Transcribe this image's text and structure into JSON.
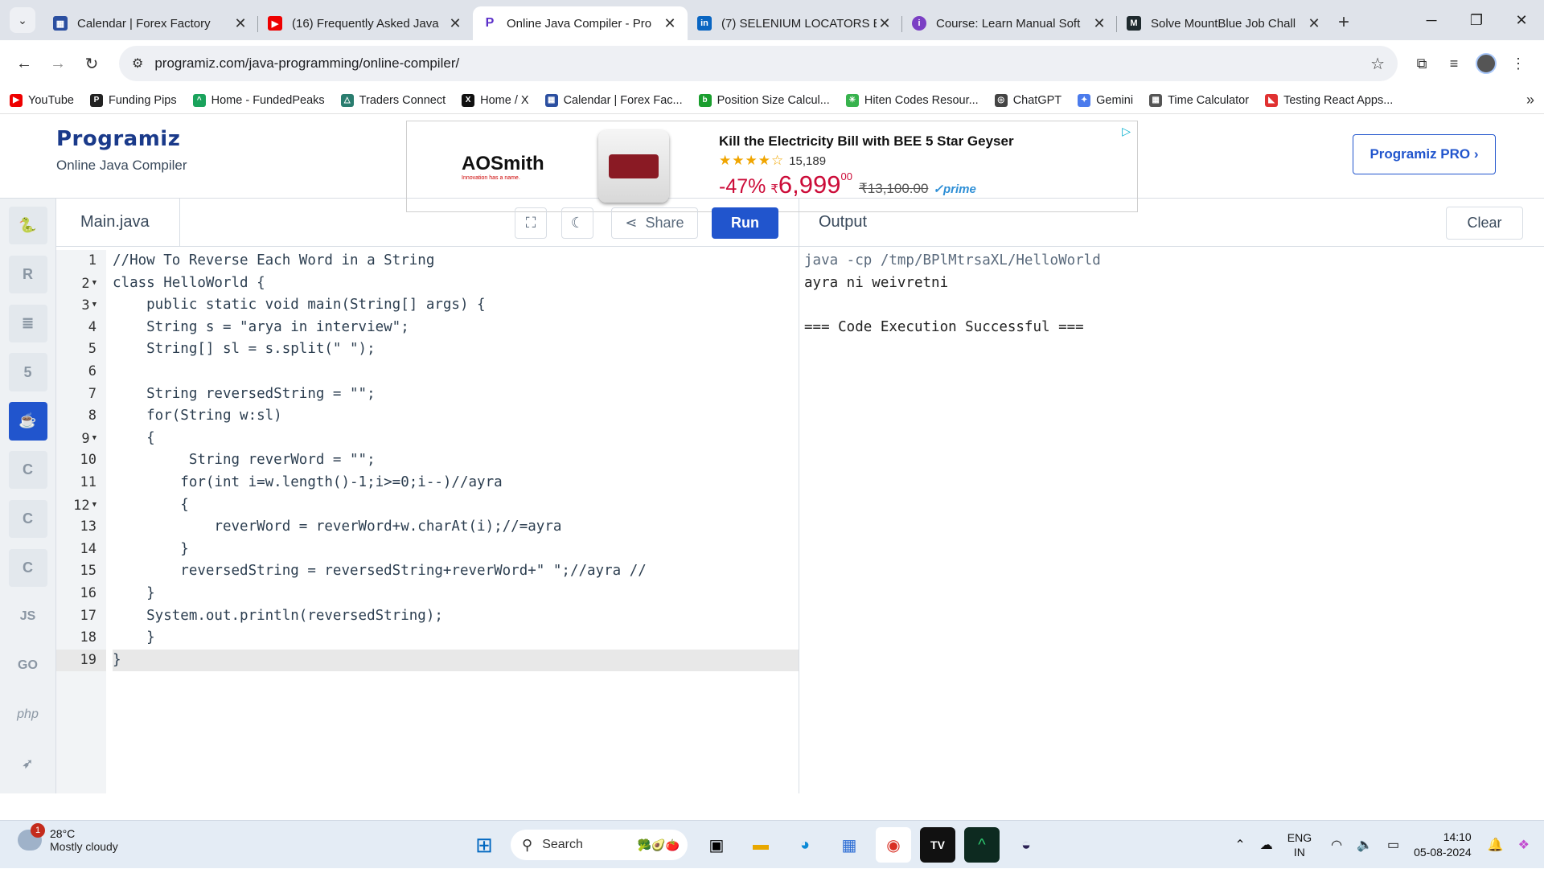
{
  "browser": {
    "tabs": [
      {
        "label": "Calendar | Forex Factory",
        "color": "#2b4fa0"
      },
      {
        "label": "(16) Frequently Asked Java",
        "color": "#e00"
      },
      {
        "label": "Online Java Compiler - Pro",
        "color": "#5b2fc9"
      },
      {
        "label": "(7) SELENIUM LOCATORS E",
        "color": "#0a66c2"
      },
      {
        "label": "Course: Learn Manual Soft",
        "color": "#7b3fc4"
      },
      {
        "label": "Solve MountBlue Job Chall",
        "color": "#1f2a2e"
      }
    ],
    "url": "programiz.com/java-programming/online-compiler/",
    "bookmarks": [
      {
        "label": "YouTube",
        "color": "#e00"
      },
      {
        "label": "Funding Pips",
        "color": "#222"
      },
      {
        "label": "Home - FundedPeaks",
        "color": "#1aa35c"
      },
      {
        "label": "Traders Connect",
        "color": "#2a7d6f"
      },
      {
        "label": "Home / X",
        "color": "#111"
      },
      {
        "label": "Calendar | Forex Fac...",
        "color": "#2b4fa0"
      },
      {
        "label": "Position Size Calcul...",
        "color": "#1a9e2e"
      },
      {
        "label": "Hiten Codes Resour...",
        "color": "#37b24d"
      },
      {
        "label": "ChatGPT",
        "color": "#444"
      },
      {
        "label": "Gemini",
        "color": "#4b7bec"
      },
      {
        "label": "Time Calculator",
        "color": "#555"
      },
      {
        "label": "Testing React Apps...",
        "color": "#e03131"
      }
    ]
  },
  "site": {
    "logo": "Programiz",
    "subtitle": "Online Java Compiler",
    "pro_button": "Programiz PRO ›"
  },
  "ad": {
    "brand": "AOSmith",
    "tagline": "Innovation has a name.",
    "headline": "Kill the Electricity Bill with BEE 5 Star Geyser",
    "reviews": "15,189",
    "discount": "-47%",
    "currency": "₹",
    "price": "6,999",
    "price_fraction": "00",
    "mrp": "₹13,100.00",
    "prime": "✓prime"
  },
  "editor": {
    "filename": "Main.java",
    "share_label": "Share",
    "run_label": "Run",
    "line_numbers": [
      "1",
      "2",
      "3",
      "4",
      "5",
      "6",
      "7",
      "8",
      "9",
      "10",
      "11",
      "12",
      "13",
      "14",
      "15",
      "16",
      "17",
      "18",
      "19"
    ],
    "code_lines": [
      "//How To Reverse Each Word in a String",
      "class HelloWorld {",
      "    public static void main(String[] args) {",
      "    String s = \"arya in interview\";",
      "    String[] sl = s.split(\" \");",
      "",
      "    String reversedString = \"\";",
      "    for(String w:sl)",
      "    {",
      "         String reverWord = \"\";",
      "        for(int i=w.length()-1;i>=0;i--)//ayra",
      "        {",
      "            reverWord = reverWord+w.charAt(i);//=ayra",
      "        }",
      "        reversedString = reversedString+reverWord+\" \";//ayra //",
      "    }",
      "    System.out.println(reversedString);",
      "    }",
      "}"
    ]
  },
  "output": {
    "title": "Output",
    "clear_label": "Clear",
    "lines": [
      "java -cp /tmp/BPlMtrsaXL/HelloWorld",
      "ayra ni weivretni",
      "",
      "=== Code Execution Successful ==="
    ]
  },
  "languages": [
    "python",
    "r",
    "sql",
    "html",
    "java",
    "c",
    "cpp",
    "csharp",
    "cplus",
    "JS",
    "GO",
    "php",
    "swift"
  ],
  "taskbar": {
    "weather_badge": "1",
    "temperature": "28°C",
    "condition": "Mostly cloudy",
    "search_placeholder": "Search",
    "lang_top": "ENG",
    "lang_bottom": "IN",
    "time": "14:10",
    "date": "05-08-2024"
  }
}
